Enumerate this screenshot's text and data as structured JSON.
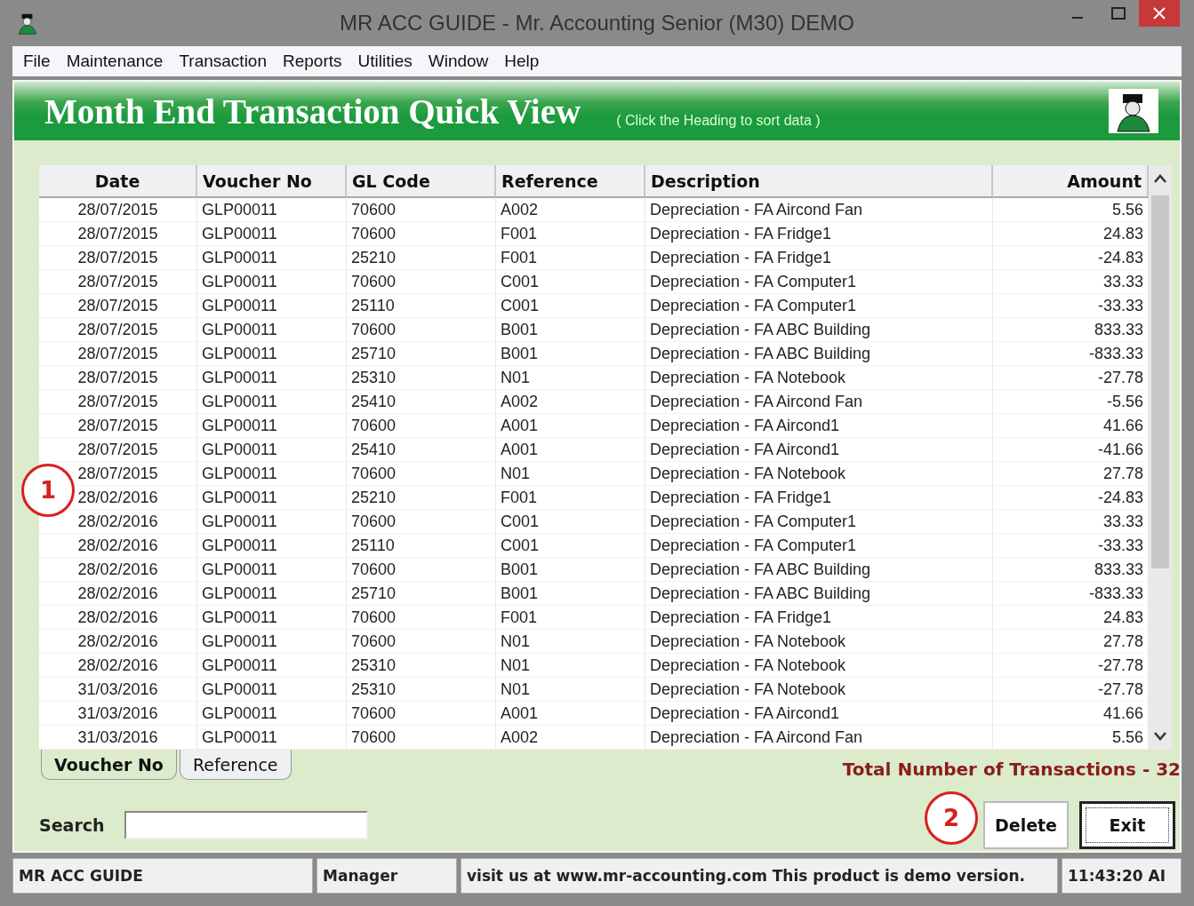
{
  "window": {
    "title": "MR ACC GUIDE - Mr. Accounting Senior (M30) DEMO"
  },
  "menu": [
    {
      "label": "File"
    },
    {
      "label": "Maintenance"
    },
    {
      "label": "Transaction"
    },
    {
      "label": "Reports"
    },
    {
      "label": "Utilities"
    },
    {
      "label": "Window"
    },
    {
      "label": "Help"
    }
  ],
  "header": {
    "title": "Month End Transaction Quick View",
    "hint": "( Click the Heading to sort data )"
  },
  "table": {
    "columns": [
      {
        "label": "Date"
      },
      {
        "label": "Voucher No"
      },
      {
        "label": "GL Code"
      },
      {
        "label": "Reference"
      },
      {
        "label": "Description"
      },
      {
        "label": "Amount"
      }
    ],
    "rows": [
      [
        "28/07/2015",
        "GLP00011",
        "70600",
        "A002",
        "Depreciation - FA Aircond Fan",
        "5.56"
      ],
      [
        "28/07/2015",
        "GLP00011",
        "70600",
        "F001",
        "Depreciation - FA Fridge1",
        "24.83"
      ],
      [
        "28/07/2015",
        "GLP00011",
        "25210",
        "F001",
        "Depreciation - FA Fridge1",
        "-24.83"
      ],
      [
        "28/07/2015",
        "GLP00011",
        "70600",
        "C001",
        "Depreciation - FA Computer1",
        "33.33"
      ],
      [
        "28/07/2015",
        "GLP00011",
        "25110",
        "C001",
        "Depreciation - FA Computer1",
        "-33.33"
      ],
      [
        "28/07/2015",
        "GLP00011",
        "70600",
        "B001",
        "Depreciation - FA ABC Building",
        "833.33"
      ],
      [
        "28/07/2015",
        "GLP00011",
        "25710",
        "B001",
        "Depreciation - FA ABC Building",
        "-833.33"
      ],
      [
        "28/07/2015",
        "GLP00011",
        "25310",
        "N01",
        "Depreciation - FA Notebook",
        "-27.78"
      ],
      [
        "28/07/2015",
        "GLP00011",
        "25410",
        "A002",
        "Depreciation - FA Aircond Fan",
        "-5.56"
      ],
      [
        "28/07/2015",
        "GLP00011",
        "70600",
        "A001",
        "Depreciation - FA Aircond1",
        "41.66"
      ],
      [
        "28/07/2015",
        "GLP00011",
        "25410",
        "A001",
        "Depreciation - FA Aircond1",
        "-41.66"
      ],
      [
        "28/07/2015",
        "GLP00011",
        "70600",
        "N01",
        "Depreciation - FA Notebook",
        "27.78"
      ],
      [
        "28/02/2016",
        "GLP00011",
        "25210",
        "F001",
        "Depreciation - FA Fridge1",
        "-24.83"
      ],
      [
        "28/02/2016",
        "GLP00011",
        "70600",
        "C001",
        "Depreciation - FA Computer1",
        "33.33"
      ],
      [
        "28/02/2016",
        "GLP00011",
        "25110",
        "C001",
        "Depreciation - FA Computer1",
        "-33.33"
      ],
      [
        "28/02/2016",
        "GLP00011",
        "70600",
        "B001",
        "Depreciation - FA ABC Building",
        "833.33"
      ],
      [
        "28/02/2016",
        "GLP00011",
        "25710",
        "B001",
        "Depreciation - FA ABC Building",
        "-833.33"
      ],
      [
        "28/02/2016",
        "GLP00011",
        "70600",
        "F001",
        "Depreciation - FA Fridge1",
        "24.83"
      ],
      [
        "28/02/2016",
        "GLP00011",
        "70600",
        "N01",
        "Depreciation - FA Notebook",
        "27.78"
      ],
      [
        "28/02/2016",
        "GLP00011",
        "25310",
        "N01",
        "Depreciation - FA Notebook",
        "-27.78"
      ],
      [
        "31/03/2016",
        "GLP00011",
        "25310",
        "N01",
        "Depreciation - FA Notebook",
        "-27.78"
      ],
      [
        "31/03/2016",
        "GLP00011",
        "70600",
        "A001",
        "Depreciation - FA Aircond1",
        "41.66"
      ],
      [
        "31/03/2016",
        "GLP00011",
        "70600",
        "A002",
        "Depreciation - FA Aircond Fan",
        "5.56"
      ]
    ]
  },
  "sort_tabs": [
    {
      "label": "Voucher No",
      "selected": true
    },
    {
      "label": "Reference",
      "selected": false
    }
  ],
  "total": "Total Number of Transactions - 32",
  "search": {
    "label": "Search"
  },
  "buttons": [
    {
      "label": "Delete",
      "focused": false
    },
    {
      "label": "Exit",
      "focused": true
    }
  ],
  "status_bar": [
    "MR ACC GUIDE",
    "Manager",
    "visit us at www.mr-accounting.com This product is demo version.",
    "11:43:20 AI"
  ],
  "annotations": [
    "1",
    "2"
  ]
}
